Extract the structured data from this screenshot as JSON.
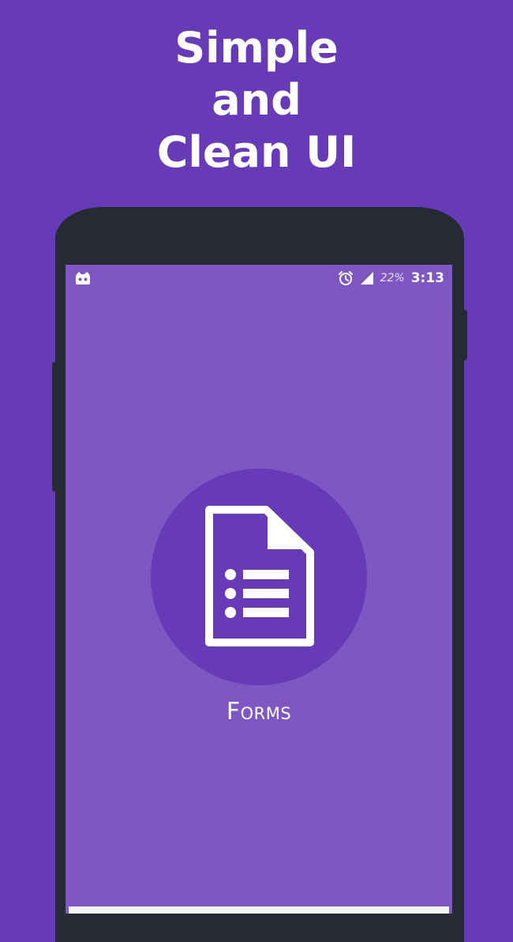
{
  "headline": {
    "line1": "Simple",
    "line2": "and",
    "line3": "Clean UI"
  },
  "status_bar": {
    "notification_icon": "cat-face-icon",
    "alarm_icon": "alarm-clock-icon",
    "signal_icon": "signal-strength-icon",
    "battery": "22%",
    "time": "3:13"
  },
  "app": {
    "icon": "forms-document-icon",
    "label": "Forms"
  },
  "colors": {
    "background": "#673ab7",
    "phone_body": "#262a35",
    "screen": "#7e57c2",
    "icon_circle": "#673ab7",
    "text": "#ffffff"
  }
}
